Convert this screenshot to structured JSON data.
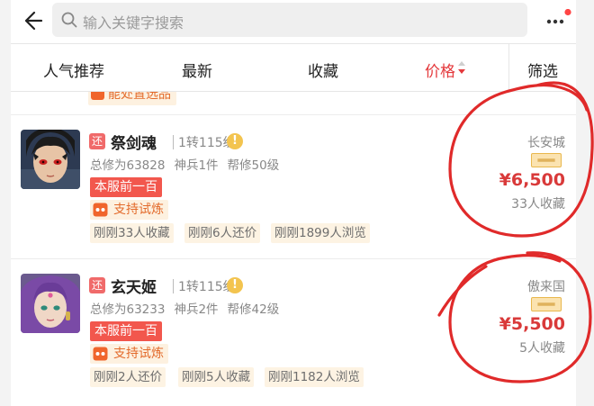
{
  "header": {
    "search_placeholder": "输入关键字搜索"
  },
  "tabs": [
    {
      "label": "人气推荐",
      "active": false
    },
    {
      "label": "最新",
      "active": false
    },
    {
      "label": "收藏",
      "active": false
    },
    {
      "label": "价格",
      "active": true
    }
  ],
  "filter_label": "筛选",
  "partial_item": {
    "tag": "能处置选品"
  },
  "items": [
    {
      "return_tag": "还",
      "name": "祭剑魂",
      "level": "1转115级",
      "warn": "!",
      "stats": [
        "总修为63828",
        "神兵1件",
        "帮修50级"
      ],
      "badge": "本服前一百",
      "trial": "支持试炼",
      "chips": [
        "刚刚33人收藏",
        "刚刚6人还价",
        "刚刚1899人浏览"
      ],
      "server": "长安城",
      "price": "¥6,500",
      "favorites": "33人收藏"
    },
    {
      "return_tag": "还",
      "name": "玄天姬",
      "level": "1转115级",
      "warn": "!",
      "stats": [
        "总修为63233",
        "神兵2件",
        "帮修42级"
      ],
      "badge": "本服前一百",
      "trial": "支持试炼",
      "chips": [
        "刚刚2人还价",
        "刚刚5人收藏",
        "刚刚1182人浏览"
      ],
      "server": "傲来国",
      "price": "¥5,500",
      "favorites": "5人收藏"
    }
  ],
  "colors": {
    "accent": "#e4393c",
    "price": "#d93a3a",
    "badge": "#f2574d",
    "trial": "#e36b2c",
    "ink_circle": "#e02a2a"
  },
  "icons": [
    "back-arrow-icon",
    "search-icon",
    "more-dots-icon",
    "notification-dot-icon",
    "sort-arrows-icon",
    "warning-icon",
    "trial-icon",
    "quality-seal-icon"
  ]
}
